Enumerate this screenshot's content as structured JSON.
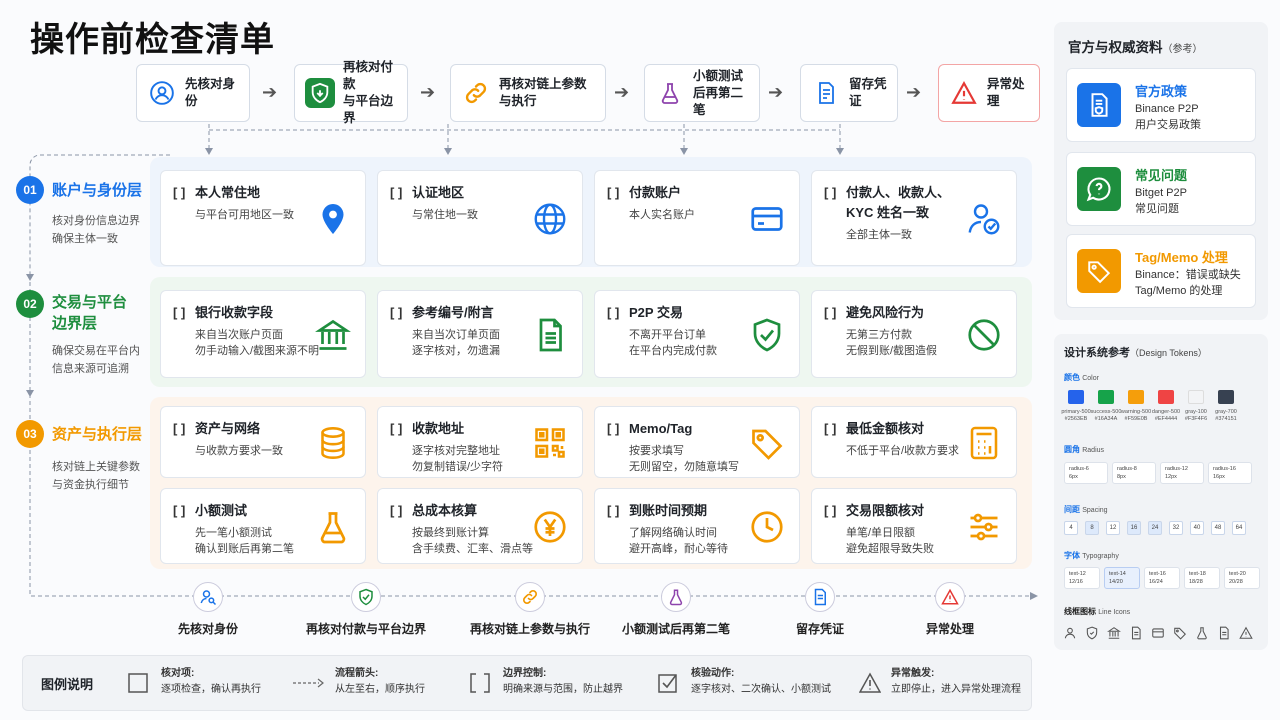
{
  "title": "操作前检查清单",
  "flow_steps": [
    {
      "label": "先核对身份",
      "icon": "user-check-icon"
    },
    {
      "label": "再核对付款与平台边界",
      "icon": "shield-icon"
    },
    {
      "label": "再核对链上参数与执行",
      "icon": "link-icon"
    },
    {
      "label": "小额测试后再第二笔",
      "icon": "flask-icon"
    },
    {
      "label": "留存凭证",
      "icon": "document-icon"
    },
    {
      "label": "异常处理",
      "icon": "warning-icon"
    }
  ],
  "flow_top_lines": [
    [
      "先核对身份"
    ],
    [
      "再核对付款",
      "与平台边界"
    ],
    [
      "再核对链上参数",
      "与执行"
    ],
    [
      "小额测试",
      "后再第二笔"
    ],
    [
      "留存凭证"
    ],
    [
      "异常处理"
    ]
  ],
  "stages": [
    {
      "num": "01",
      "title_lines": [
        "账户与身份层"
      ],
      "desc_lines": [
        "核对身份信息边界",
        "确保主体一致"
      ],
      "color": "#1a73e8"
    },
    {
      "num": "02",
      "title_lines": [
        "交易与平台",
        "边界层"
      ],
      "desc_lines": [
        "确保交易在平台内",
        "信息来源可追溯"
      ],
      "color": "#1e8e3e"
    },
    {
      "num": "03",
      "title_lines": [
        "资产与执行层"
      ],
      "desc_lines": [
        "核对链上关键参数",
        "与资金执行细节"
      ],
      "color": "#f29900"
    }
  ],
  "checkbox": "[ ]",
  "cards": [
    {
      "title": [
        "本人常住地"
      ],
      "sub": [
        "与平台可用地区一致"
      ],
      "icon": "location-pin-icon"
    },
    {
      "title": [
        "认证地区"
      ],
      "sub": [
        "与常住地一致"
      ],
      "icon": "globe-icon"
    },
    {
      "title": [
        "付款账户"
      ],
      "sub": [
        "本人实名账户"
      ],
      "icon": "card-icon"
    },
    {
      "title": [
        "付款人、收款人、",
        "KYC 姓名一致"
      ],
      "sub": [
        "全部主体一致"
      ],
      "icon": "user-check-icon"
    },
    {
      "title": [
        "银行收款字段"
      ],
      "sub": [
        "来自当次账户页面",
        "勿手动输入/截图来源不明"
      ],
      "icon": "bank-icon"
    },
    {
      "title": [
        "参考编号/附言"
      ],
      "sub": [
        "来自当次订单页面",
        "逐字核对，勿遗漏"
      ],
      "icon": "document-icon"
    },
    {
      "title": [
        "P2P 交易"
      ],
      "sub": [
        "不离开平台订单",
        "在平台内完成付款"
      ],
      "icon": "shield-check-icon"
    },
    {
      "title": [
        "避免风险行为"
      ],
      "sub": [
        "无第三方付款",
        "无假到账/截图造假"
      ],
      "icon": "prohibited-icon"
    },
    {
      "title": [
        "资产与网络"
      ],
      "sub": [
        "与收款方要求一致"
      ],
      "icon": "coins-icon"
    },
    {
      "title": [
        "收款地址"
      ],
      "sub": [
        "逐字核对完整地址",
        "勿复制错误/少字符"
      ],
      "icon": "qr-code-icon"
    },
    {
      "title": [
        "Memo/Tag"
      ],
      "sub": [
        "按要求填写",
        "无则留空，勿随意填写"
      ],
      "icon": "tag-icon"
    },
    {
      "title": [
        "最低金额核对"
      ],
      "sub": [
        "不低于平台/收款方要求"
      ],
      "icon": "calculator-icon"
    },
    {
      "title": [
        "小额测试"
      ],
      "sub": [
        "先一笔小额测试",
        "确认到账后再第二笔"
      ],
      "icon": "flask-icon"
    },
    {
      "title": [
        "总成本核算"
      ],
      "sub": [
        "按最终到账计算",
        "含手续费、汇率、滑点等"
      ],
      "icon": "yen-coin-icon"
    },
    {
      "title": [
        "到账时间预期"
      ],
      "sub": [
        "了解网络确认时间",
        "避开高峰，耐心等待"
      ],
      "icon": "clock-icon"
    },
    {
      "title": [
        "交易限额核对"
      ],
      "sub": [
        "单笔/单日限额",
        "避免超限导致失败"
      ],
      "icon": "sliders-icon"
    }
  ],
  "legend": {
    "title": "图例说明",
    "items": [
      {
        "title": "核对项:",
        "desc": "逐项检查，确认再执行"
      },
      {
        "title": "流程箭头:",
        "desc": "从左至右，顺序执行"
      },
      {
        "title": "边界控制:",
        "desc": "明确来源与范围，防止越界"
      },
      {
        "title": "核验动作:",
        "desc": "逐字核对、二次确认、小额测试"
      },
      {
        "title": "异常触发:",
        "desc": "立即停止，进入异常处理流程"
      }
    ]
  },
  "references": {
    "title": "官方与权威资料",
    "title_note": "（参考）",
    "items": [
      {
        "title": "官方政策",
        "desc": [
          "Binance P2P",
          "用户交易政策"
        ],
        "color": "#1a73e8",
        "title_color": "#1a73e8",
        "icon": "policy-document-icon"
      },
      {
        "title": "常见问题",
        "desc": [
          "Bitget P2P",
          "常见问题"
        ],
        "color": "#1e8e3e",
        "title_color": "#1e8e3e",
        "icon": "faq-icon"
      },
      {
        "title": "Tag/Memo 处理",
        "desc": [
          "Binance：错误或缺失",
          "Tag/Memo 的处理"
        ],
        "color": "#f29900",
        "title_color": "#f29900",
        "icon": "tag-icon"
      }
    ]
  },
  "design_tokens": {
    "title": "设计系统参考",
    "title_note": "（Design Tokens）",
    "color_label": "颜色",
    "color_label_en": "Color",
    "colors": [
      {
        "name": "primary-500",
        "hex": "#2563EB"
      },
      {
        "name": "success-500",
        "hex": "#16A34A"
      },
      {
        "name": "warning-500",
        "hex": "#F59E0B"
      },
      {
        "name": "danger-500",
        "hex": "#EF4444"
      },
      {
        "name": "gray-100",
        "hex": "#F3F4F6"
      },
      {
        "name": "gray-700",
        "hex": "#374151"
      }
    ],
    "radius_label": "圆角",
    "radius_label_en": "Radius",
    "radius": [
      [
        "radius-6",
        "6px"
      ],
      [
        "radius-8",
        "8px"
      ],
      [
        "radius-12",
        "12px"
      ],
      [
        "radius-16",
        "16px"
      ]
    ],
    "spacing_label": "间距",
    "spacing_label_en": "Spacing",
    "spacing": [
      "4",
      "8",
      "12",
      "16",
      "24",
      "32",
      "40",
      "48",
      "64"
    ],
    "type_label": "字体",
    "type_label_en": "Typography",
    "type": [
      [
        "text-12",
        "12/16"
      ],
      [
        "text-14",
        "14/20"
      ],
      [
        "text-16",
        "16/24"
      ],
      [
        "text-18",
        "18/28"
      ],
      [
        "text-20",
        "20/28"
      ]
    ],
    "icons_label": "线框图标",
    "icons_label_en": "Line Icons"
  }
}
